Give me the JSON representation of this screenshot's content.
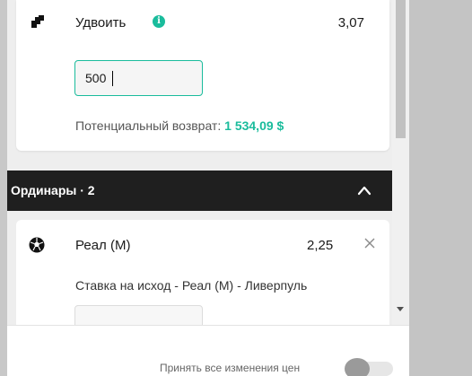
{
  "double": {
    "title": "Удвоить",
    "info_glyph": "i",
    "odds": "3,07",
    "stake_value": "500",
    "return_label": "Потенциальный возврат:",
    "return_value": "1 534,09 $"
  },
  "singles": {
    "header_label": "Ординары · 2"
  },
  "single_bet": {
    "title": "Реал (М)",
    "odds": "2,25",
    "description": "Ставка на исход - Реал (М) - Ливерпуль"
  },
  "footer": {
    "accept_label": "Принять все изменения цен",
    "accept_toggle_on": false
  },
  "colors": {
    "accent": "#1abc9c",
    "header_bar": "#1f1f1f"
  },
  "icons": [
    "double-bet-icon",
    "info-icon",
    "chevron-up-icon",
    "football-icon",
    "close-icon"
  ]
}
